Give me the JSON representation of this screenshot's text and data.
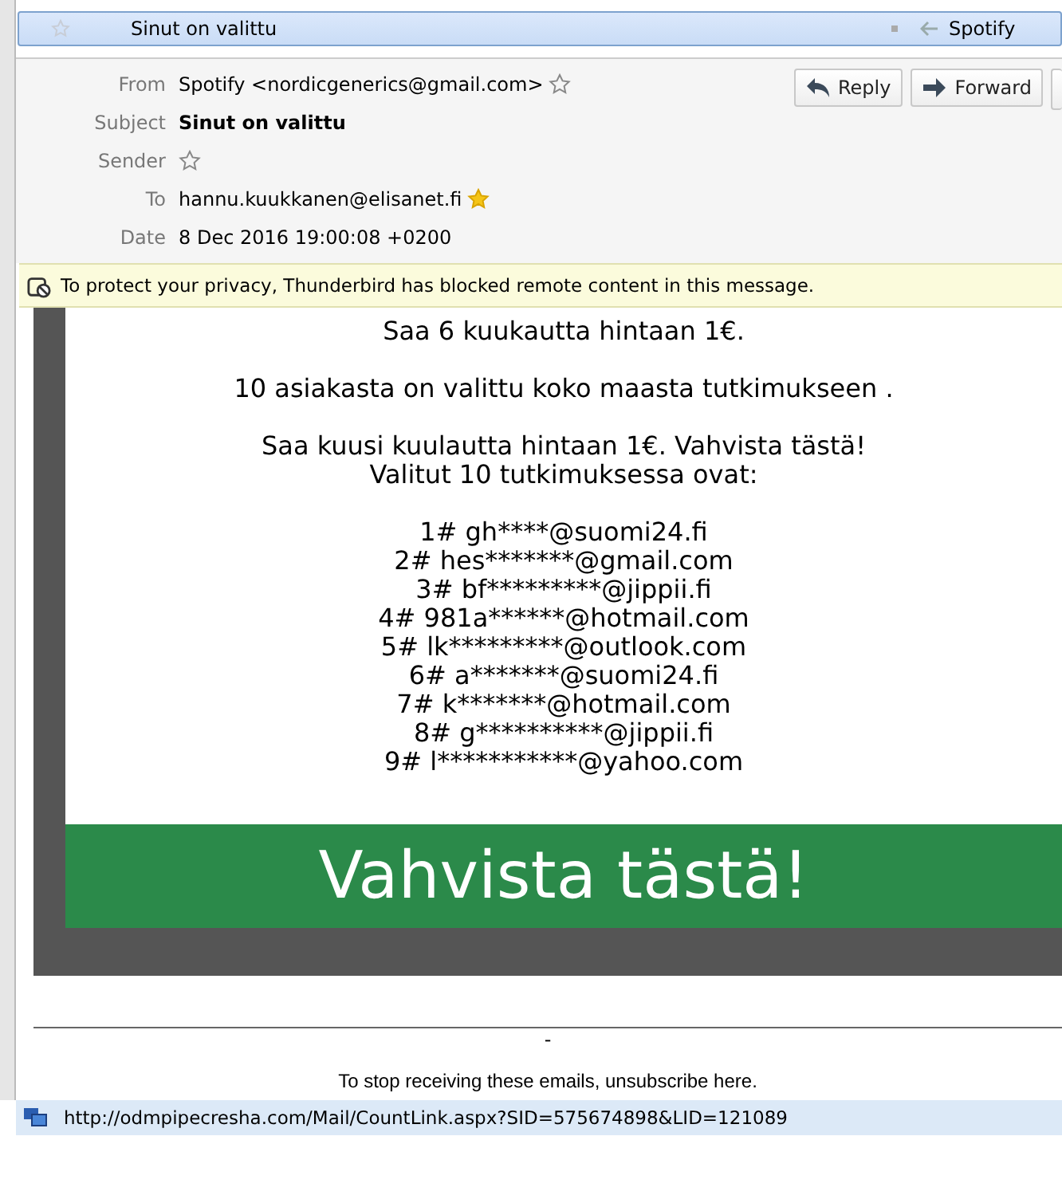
{
  "message_list": {
    "rows": [
      {
        "subject": "Sinut on valittu",
        "sender": "Spotify",
        "selected": true
      }
    ]
  },
  "header": {
    "fields": [
      {
        "label": "From",
        "value": "Spotify <nordicgenerics@gmail.com>",
        "kind": "star"
      },
      {
        "label": "Subject",
        "value": "Sinut on valittu",
        "kind": "bold"
      },
      {
        "label": "Sender",
        "kind": "star"
      },
      {
        "label": "To",
        "value": "hannu.kuukkanen@elisanet.fi",
        "kind": "starred"
      },
      {
        "label": "Date",
        "value": "8 Dec 2016 19:00:08 +0200",
        "kind": "plain"
      }
    ],
    "buttons": [
      {
        "label": "Reply",
        "kind": "reply"
      },
      {
        "label": "Forward",
        "kind": "forward"
      }
    ]
  },
  "notification": "To protect your privacy, Thunderbird has blocked remote content in this message.",
  "body": {
    "paragraphs": [
      [
        "Saa 6 kuukautta hintaan 1€."
      ],
      [
        "10 asiakasta on valittu koko maasta tutkimukseen ."
      ],
      [
        "Saa kuusi kuulautta hintaan 1€. Vahvista tästä!",
        "Valitut 10 tutkimuksessa ovat:"
      ],
      [
        "1# gh****@suomi24.fi",
        "2# hes*******@gmail.com",
        "3# bf*********@jippii.fi",
        "4# 981a******@hotmail.com",
        "5# lk*********@outlook.com",
        "6# a*******@suomi24.fi",
        "7# k*******@hotmail.com",
        "8# g**********@jippii.fi",
        "9# l***********@yahoo.com"
      ]
    ],
    "cta": "Vahvista tästä!"
  },
  "footer": {
    "dash": "-",
    "unsubscribe": "To stop receiving these emails, unsubscribe here."
  },
  "status_bar": {
    "url": "http://odmpipecresha.com/Mail/CountLink.aspx?SID=575674898&LID=121089"
  }
}
